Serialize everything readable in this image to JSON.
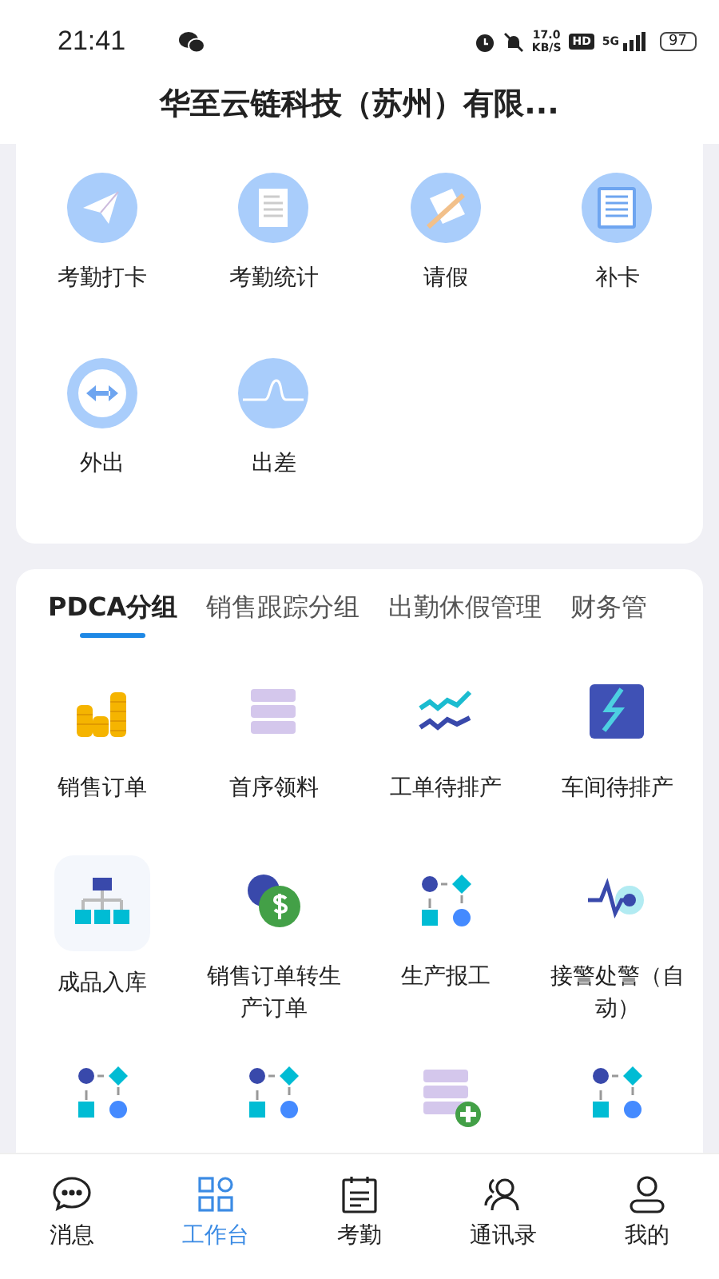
{
  "status_bar": {
    "time": "21:41",
    "speed": "17.0",
    "speed_unit": "KB/S",
    "hd": "HD",
    "network": "5G",
    "battery": "97"
  },
  "header": {
    "title": "华至云链科技（苏州）有限..."
  },
  "attendance": {
    "items": [
      {
        "label": "考勤打卡",
        "kind": "plane"
      },
      {
        "label": "考勤统计",
        "kind": "doc"
      },
      {
        "label": "请假",
        "kind": "pencil"
      },
      {
        "label": "补卡",
        "kind": "sheet"
      },
      {
        "label": "外出",
        "kind": "arrows"
      },
      {
        "label": "出差",
        "kind": "curve"
      }
    ]
  },
  "groups": {
    "tabs": [
      {
        "label": "PDCA分组",
        "selected": true
      },
      {
        "label": "销售跟踪分组",
        "selected": false
      },
      {
        "label": "出勤休假管理",
        "selected": false
      },
      {
        "label": "财务管",
        "selected": false
      }
    ],
    "items": [
      {
        "label": "销售订单",
        "kind": "coins"
      },
      {
        "label": "首序领料",
        "kind": "stack"
      },
      {
        "label": "工单待排产",
        "kind": "waves"
      },
      {
        "label": "车间待排产",
        "kind": "bolt"
      },
      {
        "label": "成品入库",
        "kind": "tree"
      },
      {
        "label": "销售订单转生产订单",
        "kind": "money"
      },
      {
        "label": "生产报工",
        "kind": "flow"
      },
      {
        "label": "接警处警（自动）",
        "kind": "pulse"
      },
      {
        "kind": "flow"
      },
      {
        "kind": "flow"
      },
      {
        "kind": "stackplus"
      },
      {
        "kind": "flow"
      }
    ]
  },
  "nav": [
    {
      "label": "消息",
      "kind": "chat",
      "selected": false
    },
    {
      "label": "工作台",
      "kind": "grid",
      "selected": true
    },
    {
      "label": "考勤",
      "kind": "calendar",
      "selected": false
    },
    {
      "label": "通讯录",
      "kind": "contacts",
      "selected": false
    },
    {
      "label": "我的",
      "kind": "person",
      "selected": false
    }
  ]
}
